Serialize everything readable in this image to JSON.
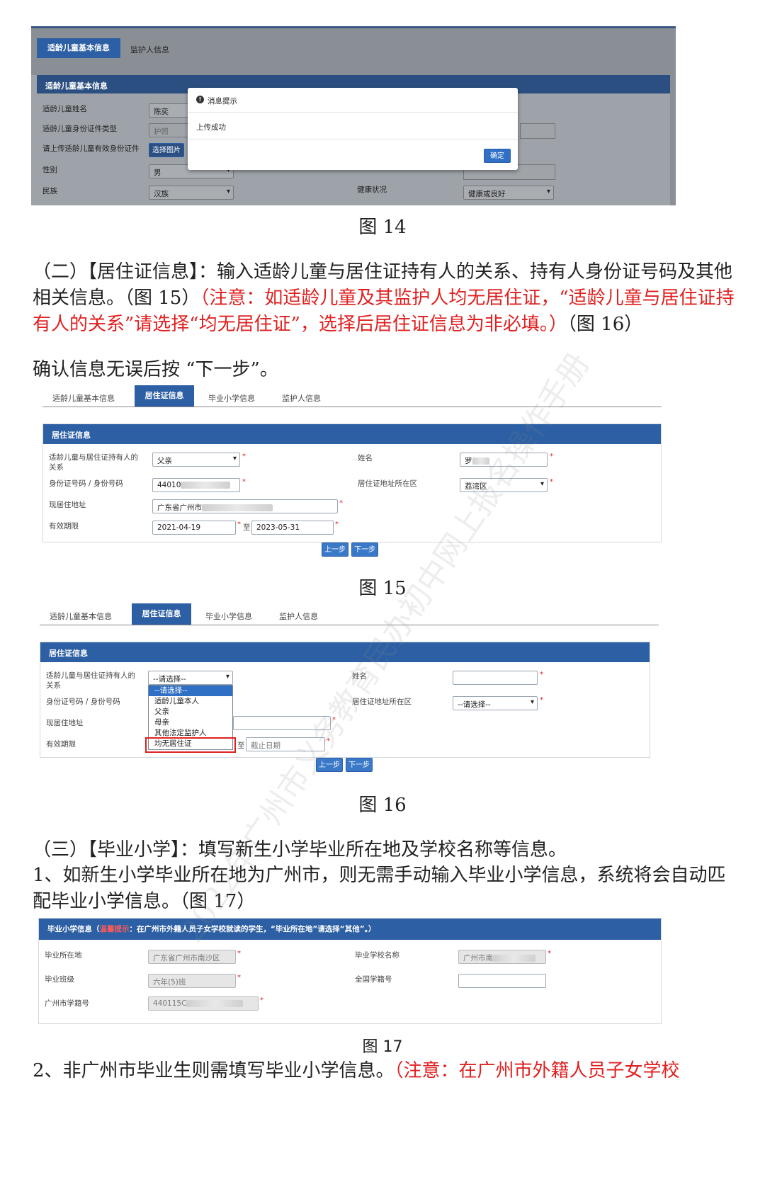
{
  "fig14": {
    "tabs": [
      "适龄儿童基本信息",
      "监护人信息"
    ],
    "section_title": "适龄儿童基本信息",
    "labels": [
      "适龄儿童姓名",
      "适龄儿童身份证件类型",
      "请上传适龄儿童有效身份证件",
      "性别",
      "民族"
    ],
    "name_value": "陈奕",
    "idtype_value": "护照",
    "upload_button": "选择图片",
    "gender_value": "男",
    "ethnic_value": "汉族",
    "health_label": "健康状况",
    "health_value": "健康或良好",
    "dialog": {
      "title": "消息提示",
      "message": "上传成功",
      "confirm": "确定"
    },
    "caption": "图 14"
  },
  "section2": {
    "p1_black": "（二）【居住证信息】：输入适龄儿童与居住证持有人的关系、持有人身份证号码及其他相关信息。（图 15）",
    "p1_red": "（注意：如适龄儿童及其监护人均无居住证，“适龄儿童与居住证持有人的关系”请选择“均无居住证”，选择后居住证信息为非必填。）",
    "p1_tail": "（图 16）",
    "p2": "确认信息无误后按 “下一步”。"
  },
  "fig15": {
    "tabs": [
      "适龄儿童基本信息",
      "居住证信息",
      "毕业小学信息",
      "监护人信息"
    ],
    "section_title": "居住证信息",
    "relation_label": "适龄儿童与居住证持有人的关系",
    "relation_value": "父亲",
    "id_label": "身份证号码 / 身份号码",
    "id_value": "44010",
    "address_label": "现居住地址",
    "address_value": "广东省广州市",
    "valid_label": "有效期限",
    "valid_from": "2021-04-19",
    "valid_to_sep": "至",
    "valid_to": "2023-05-31",
    "name_label": "姓名",
    "name_value": "罗",
    "district_label": "居住证地址所在区",
    "district_value": "荔湾区",
    "prev_button": "上一步",
    "next_button": "下一步",
    "caption": "图 15"
  },
  "fig16": {
    "tabs": [
      "适龄儿童基本信息",
      "居住证信息",
      "毕业小学信息",
      "监护人信息"
    ],
    "section_title": "居住证信息",
    "relation_label": "适龄儿童与居住证持有人的关系",
    "relation_value": "--请选择--",
    "dropdown_options": [
      "--请选择--",
      "适龄儿童本人",
      "父亲",
      "母亲",
      "其他法定监护人",
      "均无居住证"
    ],
    "id_label": "身份证号码 / 身份号码",
    "address_label": "现居住地址",
    "valid_label": "有效期限",
    "valid_to_sep": "至",
    "valid_to_placeholder": "截止日期",
    "name_label": "姓名",
    "district_label": "居住证地址所在区",
    "district_value": "--请选择--",
    "prev_button": "上一步",
    "next_button": "下一步",
    "caption": "图 16"
  },
  "section3": {
    "p1": "（三）【毕业小学】：填写新生小学毕业所在地及学校名称等信息。",
    "p2": "1、如新生小学毕业所在地为广州市，则无需手动输入毕业小学信息，系统将会自动匹配毕业小学信息。（图 17）"
  },
  "fig17": {
    "bar_title": "毕业小学信息（",
    "bar_warning": "温馨提示",
    "bar_rest": "：在广州市外籍人员子女学校就读的学生，“毕业所在地”请选择“其他”。）",
    "location_label": "毕业所在地",
    "location_value": "广东省广州市南沙区",
    "class_label": "毕业班级",
    "class_value": "六年(5)班",
    "citynum_label": "广州市学籍号",
    "citynum_value": "440115C",
    "school_label": "毕业学校名称",
    "school_value": "广州市南",
    "national_label": "全国学籍号",
    "caption": "图 17"
  },
  "section4": {
    "p_black": "2、非广州市毕业生则需填写毕业小学信息。",
    "p_red": "（注意：在广州市外籍人员子女学校"
  },
  "watermark": "2022年广州市义务教育民办初中网上报名操作手册",
  "colors": {
    "primary_blue": "#2c5fa3",
    "button_blue": "#3a78c8",
    "red_note": "#e02020",
    "highlight_box": "#e02020"
  }
}
